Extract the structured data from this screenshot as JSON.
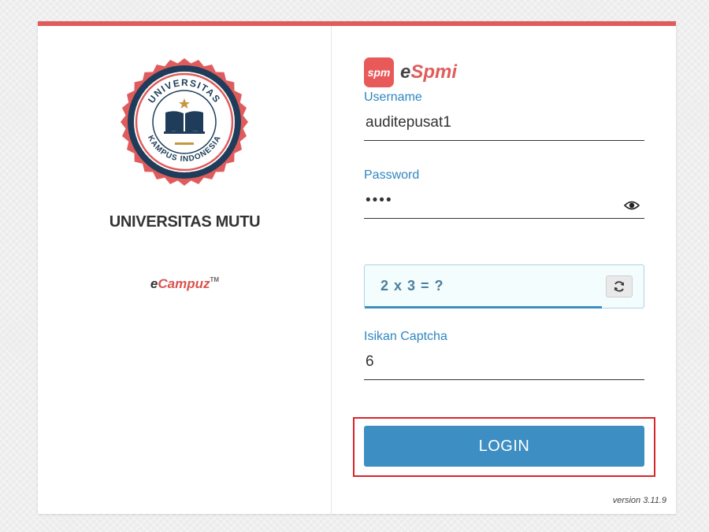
{
  "university": {
    "name": "UNIVERSITAS MUTU",
    "seal_top_text": "UNIVERSITAS",
    "seal_bottom_text": "KAMPUS INDONESIA"
  },
  "vendor": {
    "prefix": "e",
    "name": "Campuz",
    "tm": "TM"
  },
  "brand": {
    "badge": "spm",
    "prefix": "e",
    "name": "Spmi"
  },
  "form": {
    "username_label": "Username",
    "username_value": "auditepusat1",
    "password_label": "Password",
    "password_value": "••••",
    "captcha_question": "2 x 3 = ?",
    "captcha_label": "Isikan Captcha",
    "captcha_value": "6",
    "captcha_timer_fraction": 0.85,
    "login_label": "LOGIN"
  },
  "version": "version 3.11.9",
  "colors": {
    "accent_red": "#e05c5c",
    "primary_blue": "#3d8ec3",
    "navy": "#1f3d5a"
  },
  "icons": {
    "show_password": "eye-icon",
    "refresh_captcha": "refresh-icon"
  }
}
